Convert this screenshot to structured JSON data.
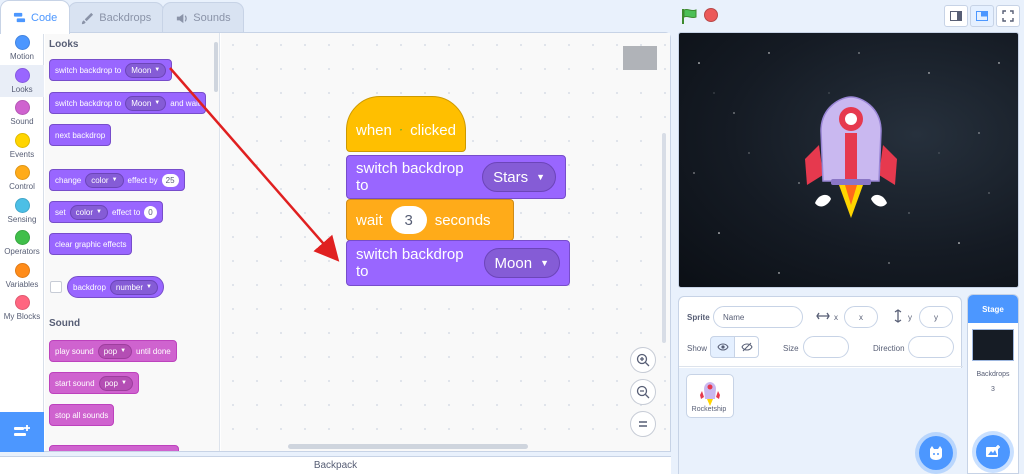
{
  "tabs": [
    {
      "label": "Code",
      "icon": "code-icon",
      "active": true
    },
    {
      "label": "Backdrops",
      "icon": "brush-icon",
      "active": false
    },
    {
      "label": "Sounds",
      "icon": "speaker-icon",
      "active": false
    }
  ],
  "categories": [
    {
      "label": "Motion",
      "color": "#4c97ff"
    },
    {
      "label": "Looks",
      "color": "#9966ff"
    },
    {
      "label": "Sound",
      "color": "#cf63cf"
    },
    {
      "label": "Events",
      "color": "#ffd500"
    },
    {
      "label": "Control",
      "color": "#ffab19"
    },
    {
      "label": "Sensing",
      "color": "#4cbfe6"
    },
    {
      "label": "Operators",
      "color": "#40bf4a"
    },
    {
      "label": "Variables",
      "color": "#ff8c1a"
    },
    {
      "label": "My Blocks",
      "color": "#ff6680"
    }
  ],
  "palette": {
    "looks_heading": "Looks",
    "switch_backdrop_text": "switch backdrop to",
    "switch_backdrop_value": "Moon",
    "switch_wait_text": "switch backdrop to",
    "switch_wait_value": "Moon",
    "switch_wait_suffix": "and wait",
    "next_backdrop": "next backdrop",
    "change_text": "change",
    "change_effect": "color",
    "change_by": "effect by",
    "change_value": "25",
    "set_text": "set",
    "set_effect": "color",
    "set_to": "effect to",
    "set_value": "0",
    "clear_effects": "clear graphic effects",
    "reporter_text": "backdrop",
    "reporter_value": "number",
    "sound_heading": "Sound",
    "play_sound_text": "play sound",
    "play_sound_value": "pop",
    "play_sound_suffix": "until done",
    "start_sound_text": "start sound",
    "start_sound_value": "pop",
    "stop_sounds": "stop all sounds"
  },
  "script": {
    "hat_when": "when",
    "hat_clicked": "clicked",
    "block1_text": "switch backdrop to",
    "block1_value": "Stars",
    "wait_text": "wait",
    "wait_value": "3",
    "wait_suffix": "seconds",
    "block2_text": "switch backdrop to",
    "block2_value": "Moon"
  },
  "annotation_color": "#e02020",
  "backpack_label": "Backpack",
  "sprite_info": {
    "sprite_label": "Sprite",
    "name_placeholder": "Name",
    "x_label": "x",
    "x_placeholder": "x",
    "y_label": "y",
    "y_placeholder": "y",
    "show_label": "Show",
    "size_label": "Size",
    "direction_label": "Direction"
  },
  "sprites": [
    {
      "name": "Rocketship"
    }
  ],
  "stage_pane": {
    "header": "Stage",
    "backdrops_label": "Backdrops",
    "backdrops_count": "3"
  },
  "colors": {
    "accent": "#4c97ff",
    "looks": "#9966ff",
    "control": "#ffab19",
    "events": "#ffbf00",
    "sound": "#cf63cf"
  }
}
